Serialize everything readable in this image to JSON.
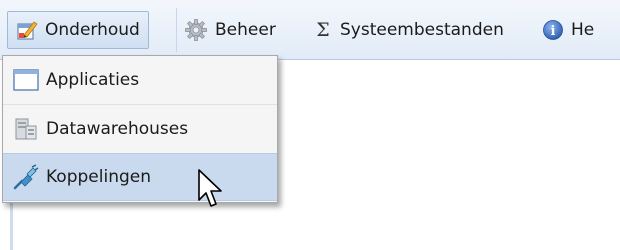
{
  "menubar": {
    "items": [
      {
        "label": "Onderhoud",
        "icon": "edit-document-icon"
      },
      {
        "label": "Beheer",
        "icon": "gear-icon"
      },
      {
        "label": "Systeembestanden",
        "icon": "sigma-icon"
      },
      {
        "label": "He",
        "icon": "info-icon"
      }
    ],
    "active_index": 0
  },
  "dropdown": {
    "items": [
      {
        "label": "Applicaties",
        "icon": "window-icon"
      },
      {
        "label": "Datawarehouses",
        "icon": "server-icon"
      },
      {
        "label": "Koppelingen",
        "icon": "plug-icon"
      }
    ],
    "hovered_index": 2
  },
  "icons": {
    "sigma": "Σ",
    "info": "i"
  },
  "colors": {
    "menubar_bg": "#e1ebf7",
    "hover_bg": "#c9d9ee",
    "dropdown_bg": "#f5f5f5",
    "info_blue": "#3a6fc4"
  }
}
